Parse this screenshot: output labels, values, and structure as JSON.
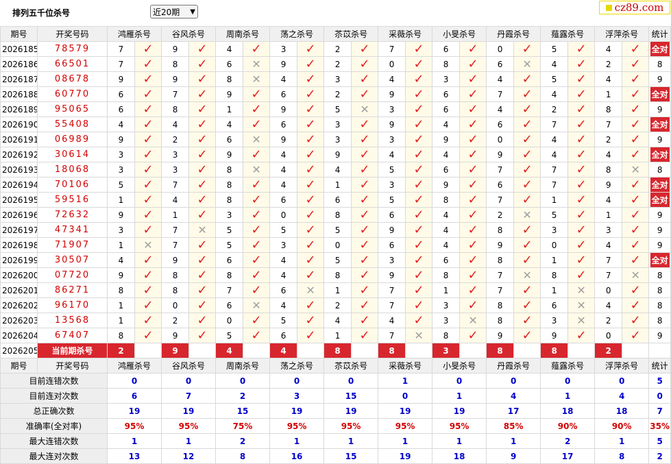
{
  "header": {
    "title": "排列五千位杀号",
    "period_select": "近20期",
    "brand": "cz89.com"
  },
  "columns": [
    "期号",
    "开奖号码",
    "鸿雁杀号",
    "谷风杀号",
    "周南杀号",
    "荡之杀号",
    "苶苡杀号",
    "采薇杀号",
    "小旻杀号",
    "丹霞杀号",
    "薤露杀号",
    "浮萍杀号",
    "统计"
  ],
  "rows": [
    {
      "period": "2026185",
      "draw": "78579",
      "kills": [
        [
          7,
          1
        ],
        [
          9,
          1
        ],
        [
          4,
          1
        ],
        [
          3,
          1
        ],
        [
          2,
          1
        ],
        [
          7,
          1
        ],
        [
          6,
          1
        ],
        [
          0,
          1
        ],
        [
          5,
          1
        ],
        [
          4,
          1
        ]
      ],
      "stat": "全对"
    },
    {
      "period": "2026186",
      "draw": "66501",
      "kills": [
        [
          7,
          1
        ],
        [
          8,
          1
        ],
        [
          6,
          0
        ],
        [
          9,
          1
        ],
        [
          2,
          1
        ],
        [
          0,
          1
        ],
        [
          8,
          1
        ],
        [
          6,
          0
        ],
        [
          4,
          1
        ],
        [
          2,
          1
        ]
      ],
      "stat": "8"
    },
    {
      "period": "2026187",
      "draw": "08678",
      "kills": [
        [
          9,
          1
        ],
        [
          9,
          1
        ],
        [
          8,
          0
        ],
        [
          4,
          1
        ],
        [
          3,
          1
        ],
        [
          4,
          1
        ],
        [
          3,
          1
        ],
        [
          4,
          1
        ],
        [
          5,
          1
        ],
        [
          4,
          1
        ]
      ],
      "stat": "9"
    },
    {
      "period": "2026188",
      "draw": "60770",
      "kills": [
        [
          6,
          1
        ],
        [
          7,
          1
        ],
        [
          9,
          1
        ],
        [
          6,
          1
        ],
        [
          2,
          1
        ],
        [
          9,
          1
        ],
        [
          6,
          1
        ],
        [
          7,
          1
        ],
        [
          4,
          1
        ],
        [
          1,
          1
        ]
      ],
      "stat": "全对"
    },
    {
      "period": "2026189",
      "draw": "95065",
      "kills": [
        [
          6,
          1
        ],
        [
          8,
          1
        ],
        [
          1,
          1
        ],
        [
          9,
          1
        ],
        [
          5,
          0
        ],
        [
          3,
          1
        ],
        [
          6,
          1
        ],
        [
          4,
          1
        ],
        [
          2,
          1
        ],
        [
          8,
          1
        ]
      ],
      "stat": "9"
    },
    {
      "period": "2026190",
      "draw": "55408",
      "kills": [
        [
          4,
          1
        ],
        [
          4,
          1
        ],
        [
          4,
          1
        ],
        [
          6,
          1
        ],
        [
          3,
          1
        ],
        [
          9,
          1
        ],
        [
          4,
          1
        ],
        [
          6,
          1
        ],
        [
          7,
          1
        ],
        [
          7,
          1
        ]
      ],
      "stat": "全对"
    },
    {
      "period": "2026191",
      "draw": "06989",
      "kills": [
        [
          9,
          1
        ],
        [
          2,
          1
        ],
        [
          6,
          0
        ],
        [
          9,
          1
        ],
        [
          3,
          1
        ],
        [
          3,
          1
        ],
        [
          9,
          1
        ],
        [
          0,
          1
        ],
        [
          4,
          1
        ],
        [
          2,
          1
        ]
      ],
      "stat": "9"
    },
    {
      "period": "2026192",
      "draw": "30614",
      "kills": [
        [
          3,
          1
        ],
        [
          3,
          1
        ],
        [
          9,
          1
        ],
        [
          4,
          1
        ],
        [
          9,
          1
        ],
        [
          4,
          1
        ],
        [
          4,
          1
        ],
        [
          9,
          1
        ],
        [
          4,
          1
        ],
        [
          4,
          1
        ]
      ],
      "stat": "全对"
    },
    {
      "period": "2026193",
      "draw": "18068",
      "kills": [
        [
          3,
          1
        ],
        [
          3,
          1
        ],
        [
          8,
          0
        ],
        [
          4,
          1
        ],
        [
          4,
          1
        ],
        [
          5,
          1
        ],
        [
          6,
          1
        ],
        [
          7,
          1
        ],
        [
          7,
          1
        ],
        [
          8,
          0
        ]
      ],
      "stat": "8"
    },
    {
      "period": "2026194",
      "draw": "70106",
      "kills": [
        [
          5,
          1
        ],
        [
          7,
          1
        ],
        [
          8,
          1
        ],
        [
          4,
          1
        ],
        [
          1,
          1
        ],
        [
          3,
          1
        ],
        [
          9,
          1
        ],
        [
          6,
          1
        ],
        [
          7,
          1
        ],
        [
          9,
          1
        ]
      ],
      "stat": "全对"
    },
    {
      "period": "2026195",
      "draw": "59516",
      "kills": [
        [
          1,
          1
        ],
        [
          4,
          1
        ],
        [
          8,
          1
        ],
        [
          6,
          1
        ],
        [
          6,
          1
        ],
        [
          5,
          1
        ],
        [
          8,
          1
        ],
        [
          7,
          1
        ],
        [
          1,
          1
        ],
        [
          4,
          1
        ]
      ],
      "stat": "全对"
    },
    {
      "period": "2026196",
      "draw": "72632",
      "kills": [
        [
          9,
          1
        ],
        [
          1,
          1
        ],
        [
          3,
          1
        ],
        [
          0,
          1
        ],
        [
          8,
          1
        ],
        [
          6,
          1
        ],
        [
          4,
          1
        ],
        [
          2,
          0
        ],
        [
          5,
          1
        ],
        [
          1,
          1
        ]
      ],
      "stat": "9"
    },
    {
      "period": "2026197",
      "draw": "47341",
      "kills": [
        [
          3,
          1
        ],
        [
          7,
          0
        ],
        [
          5,
          1
        ],
        [
          5,
          1
        ],
        [
          5,
          1
        ],
        [
          9,
          1
        ],
        [
          4,
          1
        ],
        [
          8,
          1
        ],
        [
          3,
          1
        ],
        [
          3,
          1
        ]
      ],
      "stat": "9"
    },
    {
      "period": "2026198",
      "draw": "71907",
      "kills": [
        [
          1,
          0
        ],
        [
          7,
          1
        ],
        [
          5,
          1
        ],
        [
          3,
          1
        ],
        [
          0,
          1
        ],
        [
          6,
          1
        ],
        [
          4,
          1
        ],
        [
          9,
          1
        ],
        [
          0,
          1
        ],
        [
          4,
          1
        ]
      ],
      "stat": "9"
    },
    {
      "period": "2026199",
      "draw": "30507",
      "kills": [
        [
          4,
          1
        ],
        [
          9,
          1
        ],
        [
          6,
          1
        ],
        [
          4,
          1
        ],
        [
          5,
          1
        ],
        [
          3,
          1
        ],
        [
          6,
          1
        ],
        [
          8,
          1
        ],
        [
          1,
          1
        ],
        [
          7,
          1
        ]
      ],
      "stat": "全对"
    },
    {
      "period": "2026200",
      "draw": "07720",
      "kills": [
        [
          9,
          1
        ],
        [
          8,
          1
        ],
        [
          8,
          1
        ],
        [
          4,
          1
        ],
        [
          8,
          1
        ],
        [
          9,
          1
        ],
        [
          8,
          1
        ],
        [
          7,
          0
        ],
        [
          8,
          1
        ],
        [
          7,
          0
        ]
      ],
      "stat": "8"
    },
    {
      "period": "2026201",
      "draw": "86271",
      "kills": [
        [
          8,
          1
        ],
        [
          8,
          1
        ],
        [
          7,
          1
        ],
        [
          6,
          0
        ],
        [
          1,
          1
        ],
        [
          7,
          1
        ],
        [
          1,
          1
        ],
        [
          7,
          1
        ],
        [
          1,
          0
        ],
        [
          0,
          1
        ]
      ],
      "stat": "8"
    },
    {
      "period": "2026202",
      "draw": "96170",
      "kills": [
        [
          1,
          1
        ],
        [
          0,
          1
        ],
        [
          6,
          0
        ],
        [
          4,
          1
        ],
        [
          2,
          1
        ],
        [
          7,
          1
        ],
        [
          3,
          1
        ],
        [
          8,
          1
        ],
        [
          6,
          0
        ],
        [
          4,
          1
        ]
      ],
      "stat": "8"
    },
    {
      "period": "2026203",
      "draw": "13568",
      "kills": [
        [
          1,
          1
        ],
        [
          2,
          1
        ],
        [
          0,
          1
        ],
        [
          5,
          1
        ],
        [
          4,
          1
        ],
        [
          4,
          1
        ],
        [
          3,
          0
        ],
        [
          8,
          1
        ],
        [
          3,
          0
        ],
        [
          2,
          1
        ]
      ],
      "stat": "8"
    },
    {
      "period": "2026204",
      "draw": "67407",
      "kills": [
        [
          8,
          1
        ],
        [
          9,
          1
        ],
        [
          5,
          1
        ],
        [
          6,
          1
        ],
        [
          1,
          1
        ],
        [
          7,
          0
        ],
        [
          8,
          1
        ],
        [
          9,
          1
        ],
        [
          9,
          1
        ],
        [
          0,
          1
        ]
      ],
      "stat": "9"
    }
  ],
  "current": {
    "period": "2026205",
    "label": "当前期杀号",
    "kills": [
      "2",
      "9",
      "4",
      "4",
      "8",
      "8",
      "3",
      "8",
      "8",
      "2"
    ]
  },
  "stats": [
    {
      "label": "目前连错次数",
      "values": [
        "0",
        "0",
        "0",
        "0",
        "0",
        "1",
        "0",
        "0",
        "0",
        "0",
        "5"
      ],
      "kind": "val"
    },
    {
      "label": "目前连对次数",
      "values": [
        "6",
        "7",
        "2",
        "3",
        "15",
        "0",
        "1",
        "4",
        "1",
        "4",
        "0"
      ],
      "kind": "val"
    },
    {
      "label": "总正确次数",
      "values": [
        "19",
        "19",
        "15",
        "19",
        "19",
        "19",
        "19",
        "17",
        "18",
        "18",
        "7"
      ],
      "kind": "val"
    },
    {
      "label": "准确率(全对率)",
      "values": [
        "95%",
        "95%",
        "75%",
        "95%",
        "95%",
        "95%",
        "95%",
        "85%",
        "90%",
        "90%",
        "35%"
      ],
      "kind": "rate"
    },
    {
      "label": "最大连错次数",
      "values": [
        "1",
        "1",
        "2",
        "1",
        "1",
        "1",
        "1",
        "1",
        "2",
        "1",
        "5"
      ],
      "kind": "val"
    },
    {
      "label": "最大连对次数",
      "values": [
        "13",
        "12",
        "8",
        "16",
        "15",
        "19",
        "18",
        "9",
        "17",
        "8",
        "2"
      ],
      "kind": "val"
    }
  ],
  "colors": {
    "accent_red": "#d8262e",
    "check_red": "#e0201f",
    "stat_blue": "#0000cc",
    "brand_yellow": "#e6d800"
  },
  "icons": {
    "correct": "check-icon",
    "wrong": "cross-icon"
  }
}
